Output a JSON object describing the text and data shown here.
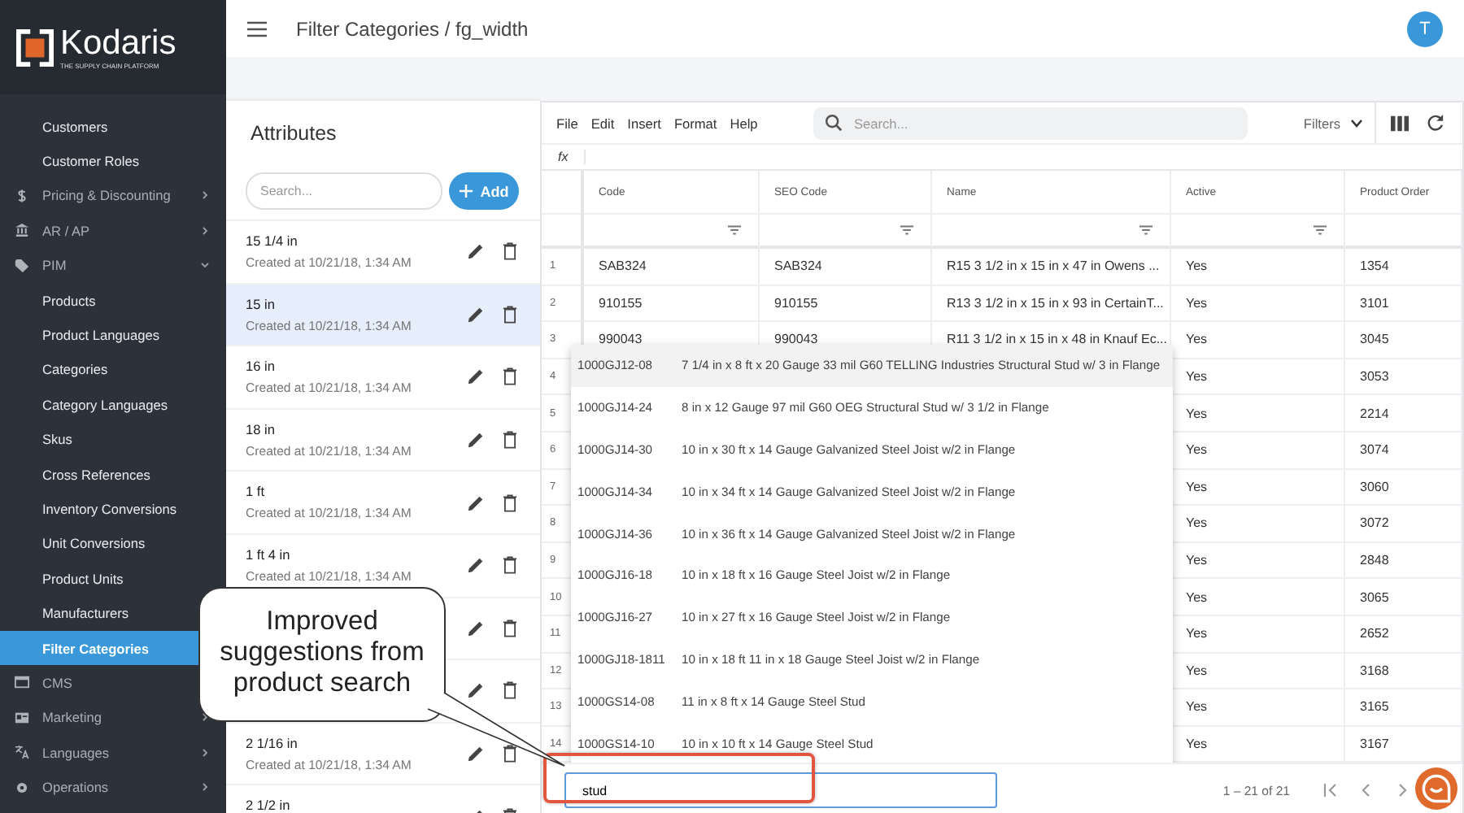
{
  "logo": {
    "name": "Kodaris",
    "tagline": "THE SUPPLY CHAIN PLATFORM"
  },
  "sidebar": {
    "items": [
      {
        "label": "Customers",
        "kind": "link",
        "selected": false
      },
      {
        "label": "Customer Roles",
        "kind": "link",
        "selected": false
      },
      {
        "label": "Pricing & Discounting",
        "kind": "group",
        "selected": false,
        "expanded": false
      },
      {
        "label": "AR / AP",
        "kind": "group",
        "selected": false,
        "expanded": false
      },
      {
        "label": "PIM",
        "kind": "group",
        "selected": false,
        "expanded": true
      },
      {
        "label": "Products",
        "kind": "link",
        "selected": false
      },
      {
        "label": "Product Languages",
        "kind": "link",
        "selected": false
      },
      {
        "label": "Categories",
        "kind": "link",
        "selected": false
      },
      {
        "label": "Category Languages",
        "kind": "link",
        "selected": false
      },
      {
        "label": "Skus",
        "kind": "link",
        "selected": false
      },
      {
        "label": "Cross References",
        "kind": "link",
        "selected": false
      },
      {
        "label": "Inventory Conversions",
        "kind": "link",
        "selected": false
      },
      {
        "label": "Unit Conversions",
        "kind": "link",
        "selected": false
      },
      {
        "label": "Product Units",
        "kind": "link",
        "selected": false
      },
      {
        "label": "Manufacturers",
        "kind": "link",
        "selected": false
      },
      {
        "label": "Filter Categories",
        "kind": "link",
        "selected": true
      },
      {
        "label": "CMS",
        "kind": "group",
        "selected": false
      },
      {
        "label": "Marketing",
        "kind": "group",
        "selected": false,
        "expanded": false
      },
      {
        "label": "Languages",
        "kind": "group",
        "selected": false,
        "expanded": false
      },
      {
        "label": "Operations",
        "kind": "group",
        "selected": false,
        "expanded": false
      }
    ]
  },
  "header": {
    "title": "Filter Categories / fg_width",
    "avatar": "T"
  },
  "attributes": {
    "title": "Attributes",
    "search": {
      "placeholder": "Search..."
    },
    "add_button": "Add",
    "items": [
      {
        "name": "15 1/4 in",
        "created": "Created at 10/21/18, 1:34 AM",
        "selected": false
      },
      {
        "name": "15 in",
        "created": "Created at 10/21/18, 1:34 AM",
        "selected": true
      },
      {
        "name": "16 in",
        "created": "Created at 10/21/18, 1:34 AM",
        "selected": false
      },
      {
        "name": "18 in",
        "created": "Created at 10/21/18, 1:34 AM",
        "selected": false
      },
      {
        "name": "1 ft",
        "created": "Created at 10/21/18, 1:34 AM",
        "selected": false
      },
      {
        "name": "1 ft 4 in",
        "created": "Created at 10/21/18, 1:34 AM",
        "selected": false
      },
      {
        "selected": false
      },
      {
        "selected": false
      },
      {
        "name": "2 1/16 in",
        "created": "Created at 10/21/18, 1:34 AM",
        "selected": false
      },
      {
        "name": "2 1/2 in",
        "selected": false
      }
    ]
  },
  "grid": {
    "menu": [
      "File",
      "Edit",
      "Insert",
      "Format",
      "Help"
    ],
    "search": {
      "placeholder": "Search..."
    },
    "filters": "Filters",
    "formula_label": "fx",
    "columns": [
      {
        "label": "Code",
        "filter": true
      },
      {
        "label": "SEO Code",
        "filter": true
      },
      {
        "label": "Name",
        "filter": true
      },
      {
        "label": "Active",
        "filter": true
      },
      {
        "label": "Product Order",
        "filter": false
      }
    ],
    "rows": [
      {
        "number": "1",
        "code": "SAB324",
        "seo_code": "SAB324",
        "name": "R15 3 1/2 in x 15 in x 47 in Owens ...",
        "active": "Yes",
        "order": "1354"
      },
      {
        "number": "2",
        "code": "910155",
        "seo_code": "910155",
        "name": "R13 3 1/2 in x 15 in x 93 in CertainT...",
        "active": "Yes",
        "order": "3101"
      },
      {
        "number": "3",
        "code": "990043",
        "seo_code": "990043",
        "name": "R11 3 1/2 in x 15 in x 48 in Knauf Ec...",
        "active": "Yes",
        "order": "3045"
      },
      {
        "number": "4",
        "active": "Yes",
        "order": "3053"
      },
      {
        "number": "5",
        "active": "Yes",
        "order": "2214"
      },
      {
        "number": "6",
        "active": "Yes",
        "order": "3074"
      },
      {
        "number": "7",
        "active": "Yes",
        "order": "3060"
      },
      {
        "number": "8",
        "active": "Yes",
        "order": "3072"
      },
      {
        "number": "9",
        "active": "Yes",
        "order": "2848"
      },
      {
        "number": "10",
        "active": "Yes",
        "order": "3065"
      },
      {
        "number": "11",
        "active": "Yes",
        "order": "2652"
      },
      {
        "number": "12",
        "active": "Yes",
        "order": "3168"
      },
      {
        "number": "13",
        "active": "Yes",
        "order": "3165"
      },
      {
        "number": "14",
        "active": "Yes",
        "order": "3167"
      }
    ],
    "suggestions": [
      {
        "code": "1000GJ12-08",
        "description": "7 1/4 in x 8 ft x 20 Gauge 33 mil G60 TELLING Industries Structural Stud w/ 3 in Flange",
        "selected": true
      },
      {
        "code": "1000GJ14-24",
        "description": "8 in x 12 Gauge 97 mil G60 OEG Structural Stud w/ 3 1/2 in Flange",
        "selected": false
      },
      {
        "code": "1000GJ14-30",
        "description": "10 in x 30 ft x 14 Gauge Galvanized Steel Joist w/2 in Flange",
        "selected": false
      },
      {
        "code": "1000GJ14-34",
        "description": "10 in x 34 ft x 14 Gauge Galvanized Steel Joist w/2 in Flange",
        "selected": false
      },
      {
        "code": "1000GJ14-36",
        "description": "10 in x 36 ft x 14 Gauge Galvanized Steel Joist w/2 in Flange",
        "selected": false
      },
      {
        "code": "1000GJ16-18",
        "description": "10 in x 18 ft x 16 Gauge Steel Joist w/2 in Flange",
        "selected": false
      },
      {
        "code": "1000GJ16-27",
        "description": "10 in x 27 ft x 16 Gauge Steel Joist w/2 in Flange",
        "selected": false
      },
      {
        "code": "1000GJ18-1811",
        "description": "10 in x 18 ft 11 in x 18 Gauge Steel Joist w/2 in Flange",
        "selected": false
      },
      {
        "code": "1000GS14-08",
        "description": "11 in x 8 ft x 14 Gauge Steel Stud",
        "selected": false
      },
      {
        "code": "1000GS14-10",
        "description": "10 in x 10 ft x 14 Gauge Steel Stud",
        "selected": false
      }
    ],
    "editor": {
      "value": "stud"
    },
    "pager": "1 – 21 of 21"
  },
  "annotation": {
    "callout": "Improved suggestions from product search"
  }
}
